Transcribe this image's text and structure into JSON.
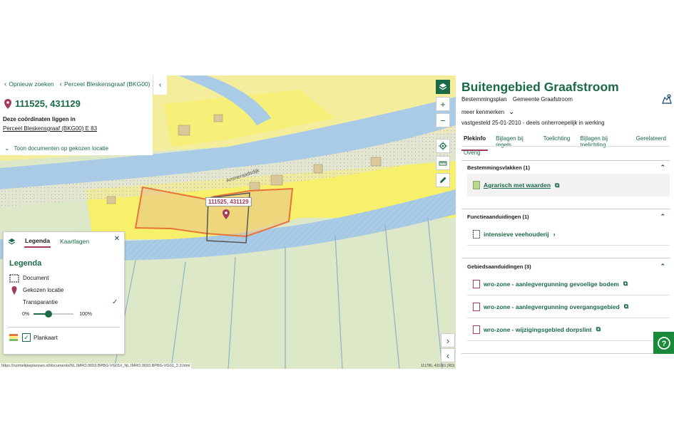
{
  "breadcrumbs": {
    "back_label": "Opnieuw zoeken",
    "perceel_label": "Perceel Bleskensgraaf (BKG00) ..."
  },
  "location": {
    "coords": "111525, 431129",
    "info_line": "Deze coördinaten liggen in",
    "perceel_link": "Perceel Bleskensgraaf (BKG00) E 83",
    "toon_docs": "Toon documenten op gekozen locatie"
  },
  "map": {
    "label": "111525, 431129",
    "street_label": "Ammeraadsdijk",
    "url_text": "https://ruimtelijkeplannen.nl/documents/NL.IMRO.0693.BPBG-VG01/r_NL.IMRO.0693.BPBG-VG01_2.3.html",
    "rd_text": "111786, 431061 (RD)",
    "colors": {
      "water": "#a9cbe6",
      "agrarisch": "#f2ecb6",
      "woon": "#f7f06a",
      "highlight": "#e8743a",
      "selected": "#555555"
    }
  },
  "legend": {
    "tabs": [
      "Legenda",
      "Kaartlagen"
    ],
    "active_tab": 0,
    "title": "Legenda",
    "items": {
      "document": "Document",
      "gekozen": "Gekozen locatie",
      "transparantie": "Transparantie"
    },
    "slider": {
      "min_label": "0%",
      "max_label": "100%",
      "value": 0.38
    },
    "plankaart": "Plankaart"
  },
  "plan": {
    "title": "Buitengebied Graafstroom",
    "type": "Bestemmingsplan",
    "municipality": "Gemeente Graafstroom",
    "more": "meer kenmerken",
    "status": "vastgesteld 25-01-2010 - deels onherroepelijk in werking",
    "tabs": [
      "Plekinfo",
      "Bijlagen bij regels",
      "Toelichting",
      "Bijlagen bij toelichting",
      "Gerelateerd"
    ],
    "tab_overig": "Overig",
    "sections": [
      {
        "title": "Bestemmingsvlakken (1)",
        "items": [
          {
            "label": "Agrarisch met waarden",
            "swatch": "#b8d88a"
          }
        ]
      },
      {
        "title": "Functieaanduidingen (1)",
        "items": [
          {
            "label": "intensieve veehouderij"
          }
        ]
      },
      {
        "title": "Gebiedsaanduidingen (3)",
        "items": [
          {
            "label": "wro-zone - aanlegvergunning gevoelige bodem",
            "swatch": "#c0394b"
          },
          {
            "label": "wro-zone - aanlegvergunning overgangsgebied",
            "swatch": "#c0394b"
          },
          {
            "label": "wro-zone - wijzigingsgebied dorpslint",
            "swatch": "#c0394b"
          }
        ]
      }
    ]
  }
}
